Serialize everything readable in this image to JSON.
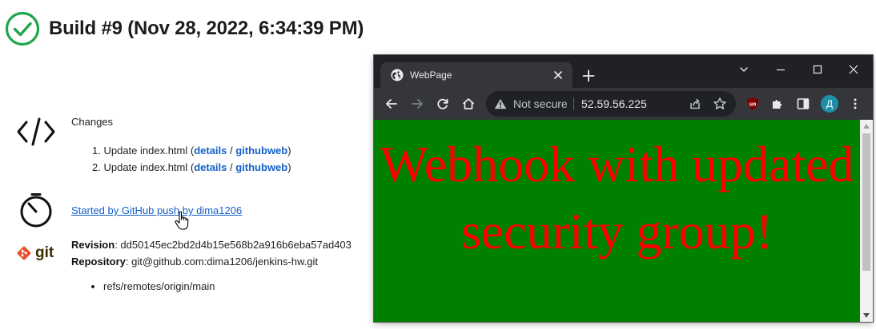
{
  "build": {
    "title": "Build #9 (Nov 28, 2022, 6:34:39 PM)",
    "status": "success"
  },
  "changes": {
    "label": "Changes",
    "items": [
      {
        "num": "1.",
        "text": "Update index.html (",
        "details": "details",
        "sep": " / ",
        "githubweb": "githubweb",
        "close": ")"
      },
      {
        "num": "2.",
        "text": "Update index.html (",
        "details": "details",
        "sep": " / ",
        "githubweb": "githubweb",
        "close": ")"
      }
    ]
  },
  "cause": {
    "text": "Started by GitHub push by dima1206"
  },
  "scm": {
    "logo_text": "git",
    "revision_label": "Revision",
    "revision": "dd50145ec2bd2d4b15e568b2a916b6eba57ad403",
    "repository_label": "Repository",
    "repository": "git@github.com:dima1206/jenkins-hw.git",
    "refs": [
      "refs/remotes/origin/main"
    ]
  },
  "browser": {
    "tab_title": "WebPage",
    "security_label": "Not secure",
    "url": "52.59.56.225",
    "profile_initial": "Д",
    "page_heading": "Webhook with updated security group!",
    "page_bg": "#008000",
    "heading_color": "#ff0000"
  },
  "colors": {
    "success": "#1ea64b",
    "link": "#1460c8"
  }
}
